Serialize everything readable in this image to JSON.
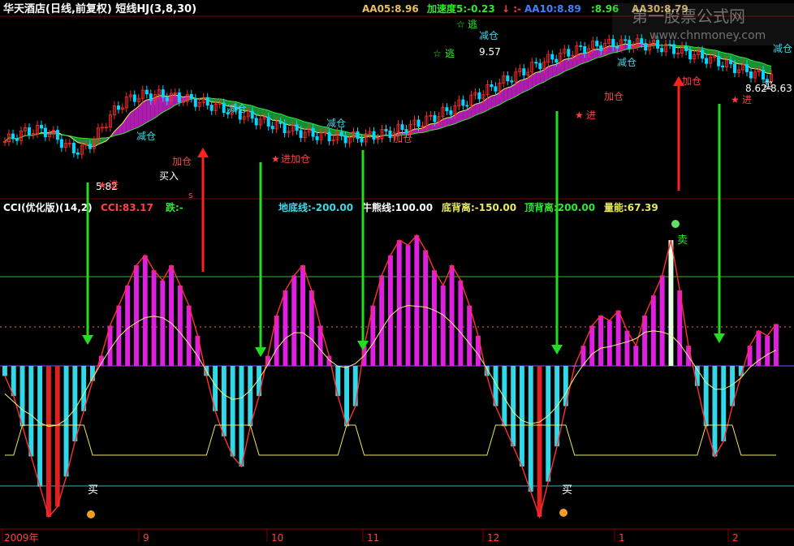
{
  "header": {
    "title": "华天酒店(日线,前复权) 短线HJ(3,8,30)",
    "aa05": "AA05:8.96",
    "jiasudu": "加速度5:-0.23",
    "dash": "↓ :-",
    "aa10": "AA10:8.89",
    "mid": ":8.96",
    "aa30": "AA30:8.79"
  },
  "watermark": {
    "line1": "第一股票公式网",
    "line2": "www.chnmoney.com"
  },
  "price_panel": {
    "annotations": {
      "low_price": "5.82",
      "high_price": "9.57",
      "last_price": "8.62-8.63",
      "reduce": "减仓",
      "add": "加仓",
      "buy_in": "买入",
      "enter": "进",
      "enter_add": "进加仓",
      "escape": "逃",
      "small_buy": "买",
      "s_mark": "s"
    }
  },
  "indicator_header": {
    "name": "CCI(优化版)(14,2)",
    "cci": "CCI:83.17",
    "die": "跌:-",
    "didi": "地底线:-200.00",
    "niuxiong": "牛熊线:100.00",
    "dibeili": "底背离:-150.00",
    "dingbeili": "顶背离:200.00",
    "liangneng": "量能:67.39"
  },
  "indicator_marks": {
    "buy": "买",
    "sell": "卖"
  },
  "x_axis": {
    "labels": [
      "2009年",
      "9",
      "10",
      "11",
      "12",
      "1",
      "2"
    ]
  },
  "colors": {
    "background": "#000000",
    "price_up": "#ff2a2a",
    "price_down": "#00d8ff",
    "ribbon_up": "#c020c0",
    "ribbon_down": "#1a9e3a",
    "cci_pos": "#e020e0",
    "cci_neg": "#30d8e8",
    "arrow_green": "#22dd22",
    "arrow_red": "#ff2020",
    "zero_line": "#6060ff",
    "yellow": "#e8e860"
  },
  "chart_data": {
    "type": "bar",
    "title": "CCI(优化版)(14,2)",
    "x_labels": [
      "2009年",
      "9",
      "10",
      "11",
      "12",
      "1",
      "2"
    ],
    "cci": [
      -20,
      -60,
      -120,
      -180,
      -240,
      -300,
      -280,
      -220,
      -150,
      -90,
      -30,
      20,
      80,
      120,
      160,
      200,
      220,
      190,
      170,
      200,
      160,
      120,
      60,
      -20,
      -90,
      -140,
      -180,
      -200,
      -120,
      -60,
      20,
      100,
      150,
      180,
      200,
      150,
      80,
      20,
      -60,
      -120,
      -80,
      40,
      120,
      180,
      220,
      250,
      240,
      260,
      230,
      190,
      160,
      200,
      170,
      120,
      60,
      -20,
      -80,
      -120,
      -160,
      -200,
      -250,
      -300,
      -230,
      -160,
      -80,
      0,
      40,
      80,
      100,
      90,
      110,
      70,
      40,
      100,
      140,
      180,
      250,
      150,
      40,
      -40,
      -120,
      -180,
      -150,
      -80,
      -20,
      40,
      70,
      60,
      83.17
    ],
    "reference_lines": {
      "didi": -200.0,
      "niuxiong": 100.0,
      "dibeili": -150.0,
      "dingbeili": 200.0
    },
    "liangneng": 67.39
  }
}
